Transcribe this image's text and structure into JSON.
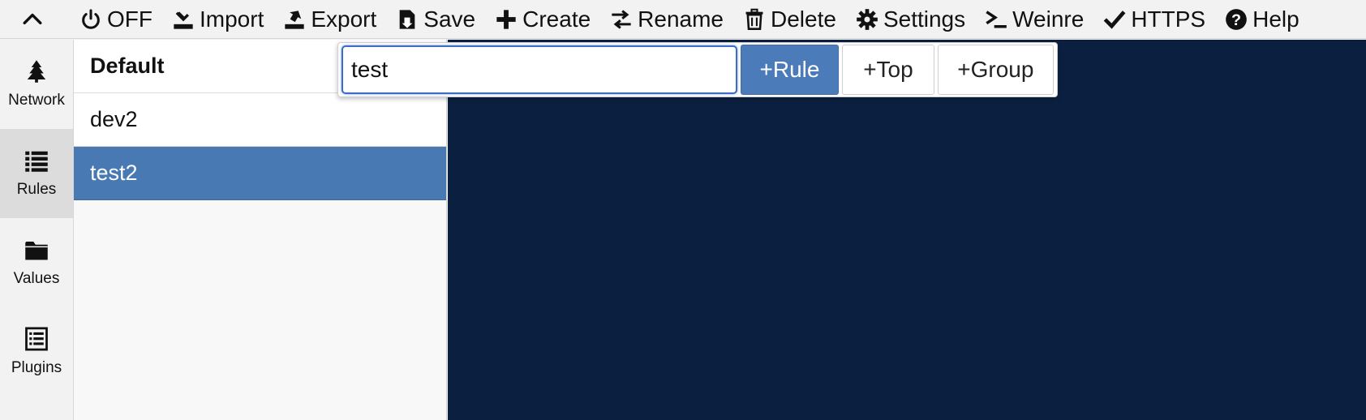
{
  "toolbar": {
    "collapse_icon": "chevron-up-icon",
    "items": [
      {
        "label": "OFF",
        "icon": "power-icon"
      },
      {
        "label": "Import",
        "icon": "import-icon"
      },
      {
        "label": "Export",
        "icon": "export-icon"
      },
      {
        "label": "Save",
        "icon": "save-icon"
      },
      {
        "label": "Create",
        "icon": "plus-icon"
      },
      {
        "label": "Rename",
        "icon": "swap-icon"
      },
      {
        "label": "Delete",
        "icon": "trash-icon"
      },
      {
        "label": "Settings",
        "icon": "gear-icon"
      },
      {
        "label": "Weinre",
        "icon": "terminal-icon"
      },
      {
        "label": "HTTPS",
        "icon": "check-icon"
      },
      {
        "label": "Help",
        "icon": "question-icon"
      }
    ]
  },
  "nav": {
    "items": [
      {
        "label": "Network",
        "icon": "tree-icon"
      },
      {
        "label": "Rules",
        "icon": "list-icon"
      },
      {
        "label": "Values",
        "icon": "folder-icon"
      },
      {
        "label": "Plugins",
        "icon": "plugin-list-icon"
      }
    ],
    "active_index": 1
  },
  "rules": {
    "items": [
      {
        "label": "Default"
      },
      {
        "label": "dev2"
      },
      {
        "label": "test2"
      }
    ],
    "selected_index": 2
  },
  "create_popover": {
    "input_value": "test",
    "buttons": [
      {
        "label": "+Rule"
      },
      {
        "label": "+Top"
      },
      {
        "label": "+Group"
      }
    ]
  },
  "colors": {
    "editor_bg": "#0b2040",
    "selected_bg": "#4879b3",
    "accent": "#3b6cc4"
  }
}
